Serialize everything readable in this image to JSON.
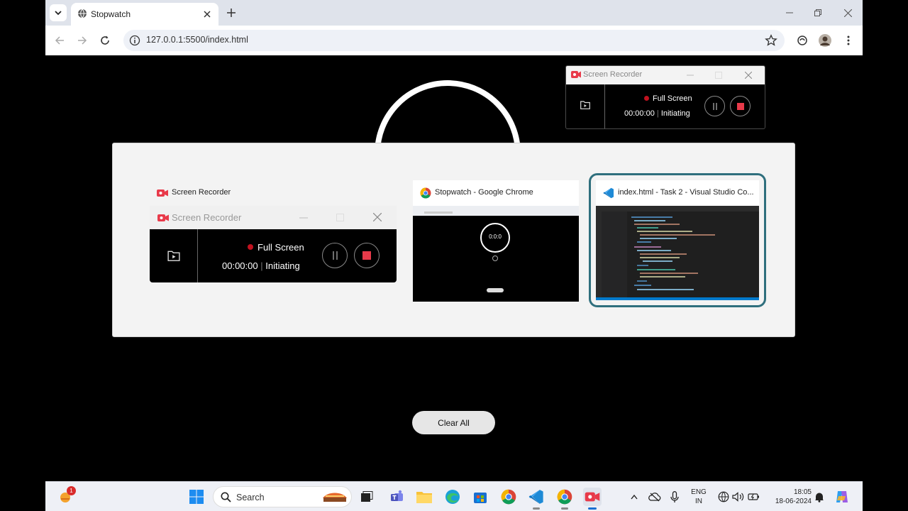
{
  "browser": {
    "tab_title": "Stopwatch",
    "url": "127.0.0.1:5500/index.html"
  },
  "recorder_window": {
    "title": "Screen Recorder",
    "mode": "Full Screen",
    "time": "00:00:00",
    "status": "Initiating"
  },
  "switcher": {
    "cards": [
      {
        "label": "Screen Recorder"
      },
      {
        "label": "Stopwatch - Google Chrome",
        "preview_time": "0:0:0"
      },
      {
        "label": "index.html - Task 2 - Visual Studio Co..."
      }
    ],
    "preview_recorder": {
      "title": "Screen Recorder",
      "mode": "Full Screen",
      "time": "00:00:00",
      "status": "Initiating"
    }
  },
  "page": {
    "clear_all_label": "Clear All"
  },
  "taskbar": {
    "search_label": "Search",
    "widget_badge": "1",
    "lang_line1": "ENG",
    "lang_line2": "IN",
    "time": "18:05",
    "date": "18-06-2024"
  },
  "colors": {
    "accent_teal": "#2f6f7d",
    "record_red": "#e83a4a",
    "vscode_blue": "#1e8ad6"
  }
}
